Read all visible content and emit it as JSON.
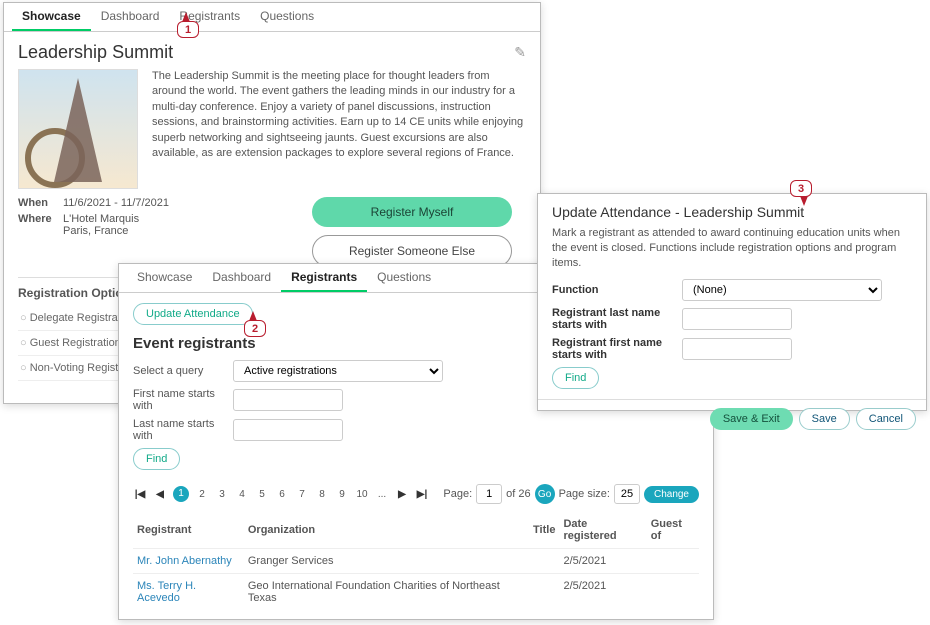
{
  "panel1": {
    "tabs": [
      "Showcase",
      "Dashboard",
      "Registrants",
      "Questions"
    ],
    "activeTab": 0,
    "title": "Leadership Summit",
    "description": "The Leadership Summit is the meeting place for thought leaders from around the world. The event gathers the leading minds in our industry for a multi-day conference. Enjoy a variety of panel discussions, instruction sessions, and brainstorming activities. Earn up to 14 CE units while enjoying superb networking and sightseeing jaunts. Guest excursions are also available, as are extension packages to explore several regions of France.",
    "when_label": "When",
    "when_value": "11/6/2021 - 11/7/2021",
    "where_label": "Where",
    "where_value": "L'Hotel Marquis\nParis, France",
    "btn_register_self": "Register Myself",
    "btn_register_other": "Register Someone Else",
    "reg_options_title": "Registration Options",
    "reg_options": [
      "Delegate Registration",
      "Guest Registration",
      "Non-Voting Registration"
    ]
  },
  "panel2": {
    "tabs": [
      "Showcase",
      "Dashboard",
      "Registrants",
      "Questions"
    ],
    "activeTab": 2,
    "btn_update_attendance": "Update Attendance",
    "heading": "Event registrants",
    "query_label": "Select a query",
    "query_value": "Active registrations",
    "fn_label": "First name starts with",
    "ln_label": "Last name starts with",
    "btn_find": "Find",
    "pager": {
      "pages": [
        "1",
        "2",
        "3",
        "4",
        "5",
        "6",
        "7",
        "8",
        "9",
        "10",
        "..."
      ],
      "current": 1,
      "page_label": "Page:",
      "page_input": "1",
      "of_label": "of 26",
      "go": "Go",
      "size_label": "Page size:",
      "size_input": "25",
      "change": "Change"
    },
    "columns": [
      "Registrant",
      "Organization",
      "Title",
      "Date registered",
      "Guest of"
    ],
    "rows": [
      {
        "name": "Mr. John Abernathy",
        "org": "Granger Services",
        "title": "",
        "date": "2/5/2021",
        "guest": ""
      },
      {
        "name": "Ms. Terry H. Acevedo",
        "org": "Geo International Foundation Charities of Northeast Texas",
        "title": "",
        "date": "2/5/2021",
        "guest": ""
      }
    ]
  },
  "panel3": {
    "title": "Update Attendance - Leadership Summit",
    "description": "Mark a registrant as attended to award continuing education units when the event is closed. Functions include registration options and program items.",
    "function_label": "Function",
    "function_value": "(None)",
    "ln_label": "Registrant last name starts with",
    "fn_label": "Registrant first name starts with",
    "btn_find": "Find",
    "btn_save_exit": "Save & Exit",
    "btn_save": "Save",
    "btn_cancel": "Cancel"
  },
  "callouts": {
    "c1": "1",
    "c2": "2",
    "c3": "3"
  }
}
